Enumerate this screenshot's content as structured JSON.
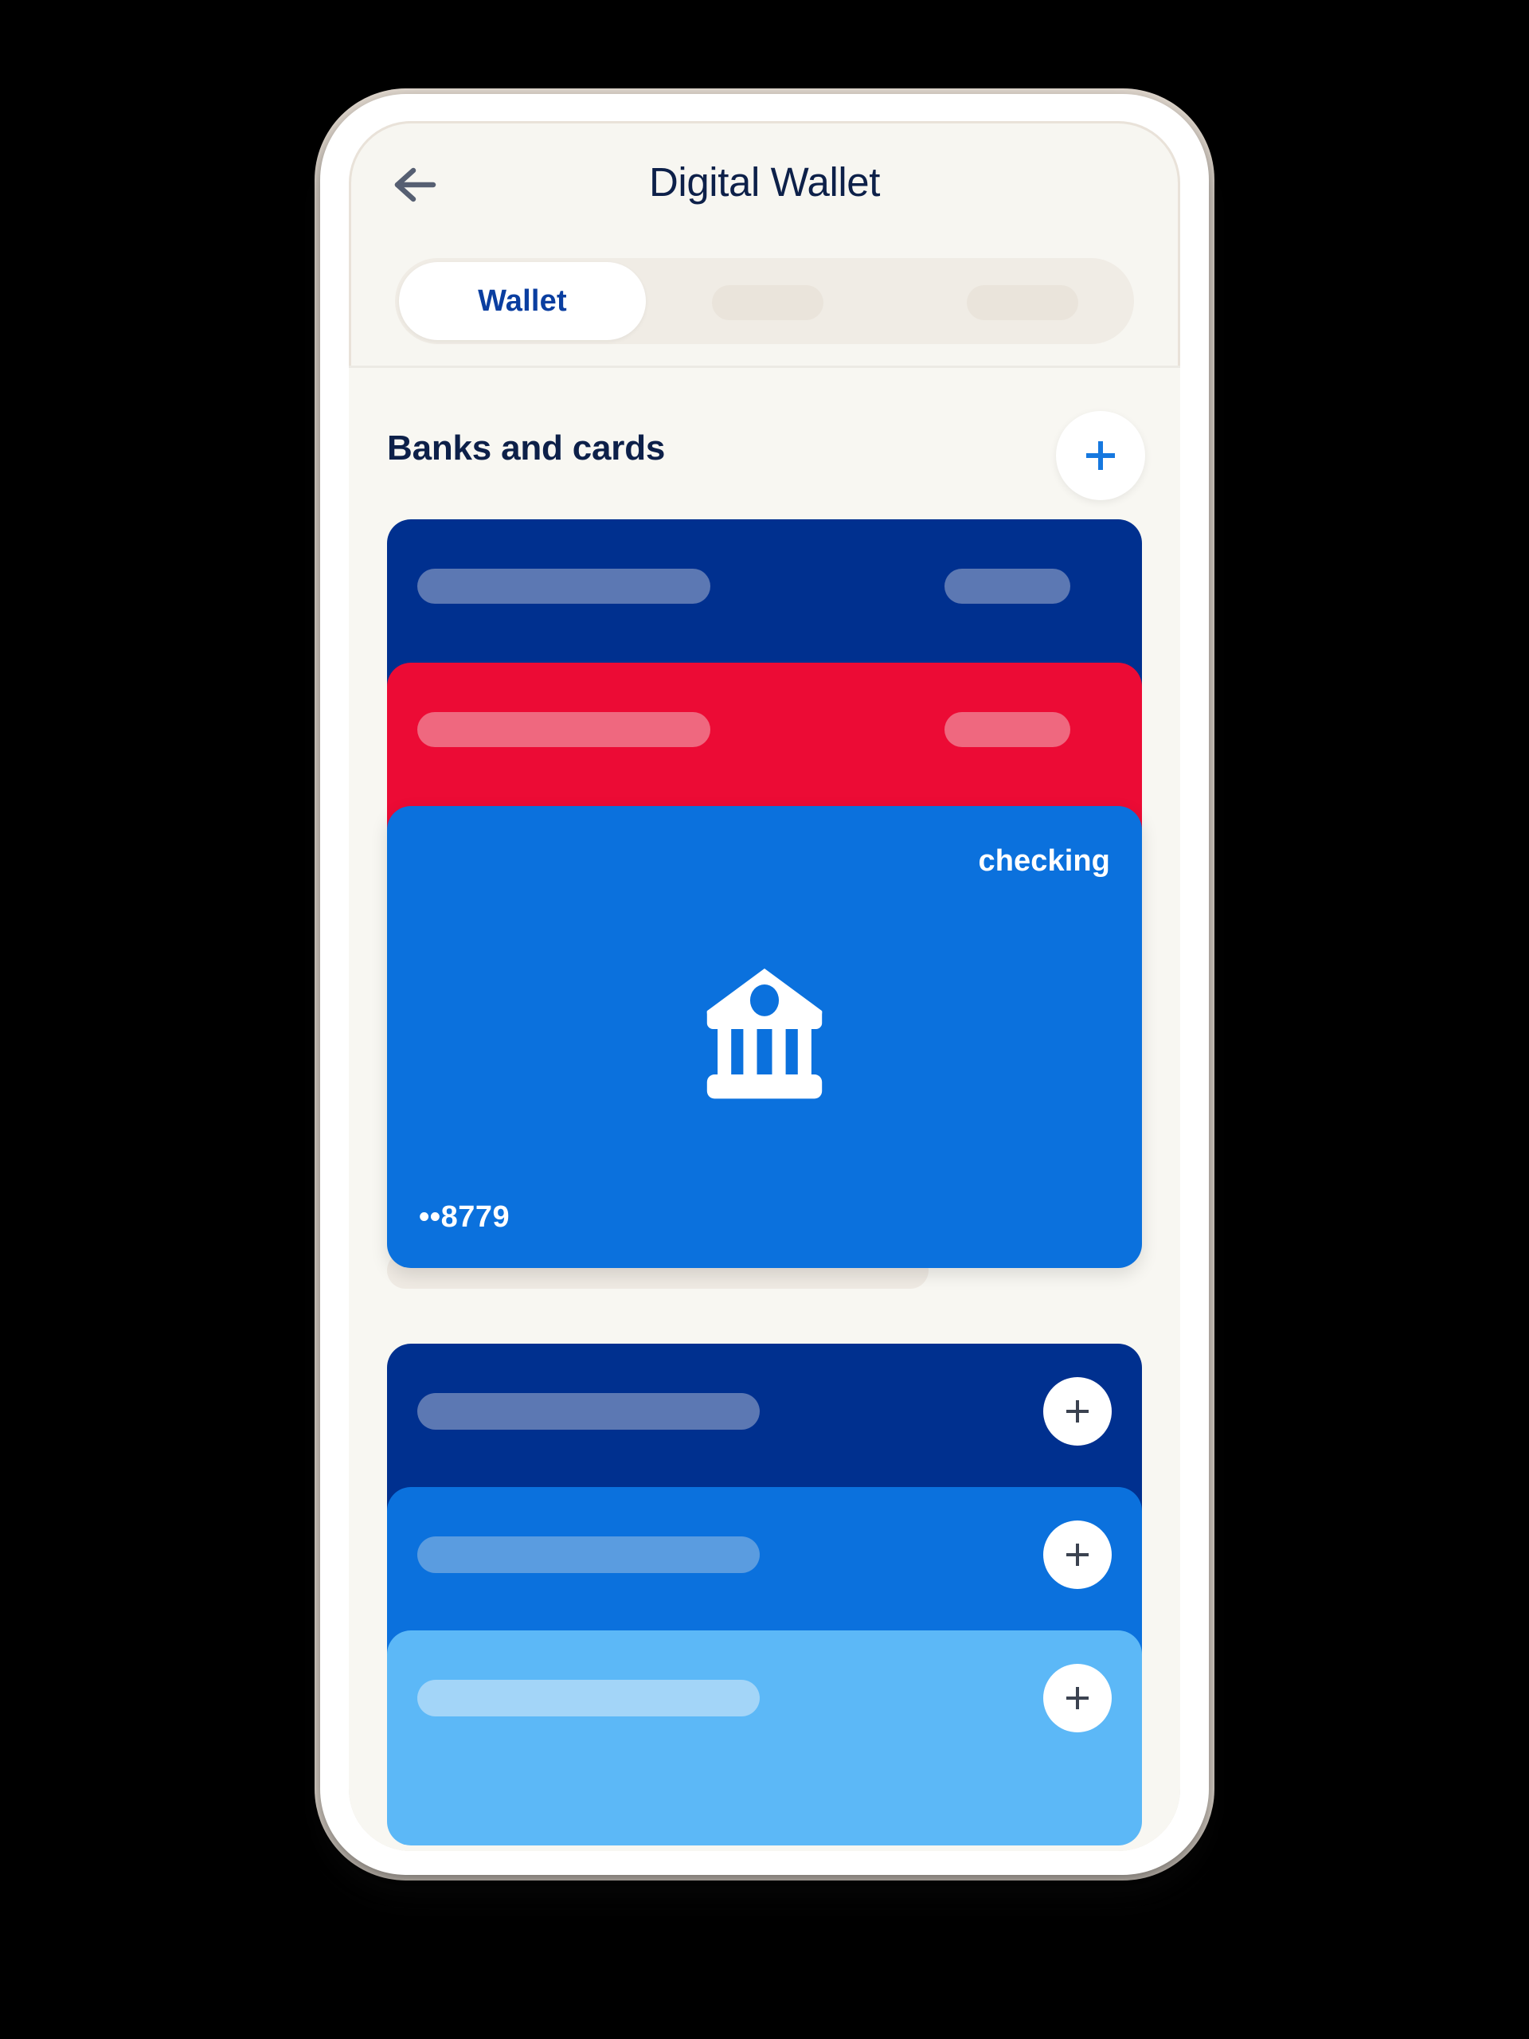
{
  "header": {
    "title": "Digital Wallet",
    "back_icon": "arrow-left-icon"
  },
  "tabs": {
    "active_label": "Wallet",
    "ghost_tabs": [
      "",
      ""
    ]
  },
  "section": {
    "title": "Banks and cards",
    "add_icon": "plus-icon"
  },
  "cards": [
    {
      "name": "card-navy",
      "color": "#00308f",
      "state": "collapsed"
    },
    {
      "name": "card-red",
      "color": "#ec0b35",
      "state": "collapsed"
    },
    {
      "name": "card-blue",
      "color": "#0b71dd",
      "state": "expanded",
      "account_type": "checking",
      "masked_number": "••8779",
      "icon": "bank-icon"
    }
  ],
  "add_rows": [
    {
      "name": "add-row-navy",
      "color": "#00308f",
      "action_icon": "plus-icon"
    },
    {
      "name": "add-row-blue",
      "color": "#0b71dd",
      "action_icon": "plus-icon"
    },
    {
      "name": "add-row-lightblue",
      "color": "#5cb8f7",
      "action_icon": "plus-icon"
    }
  ],
  "colors": {
    "accent_blue": "#1678df",
    "brand_navy": "#0d2049",
    "tab_active_text": "#0a3ea0",
    "screen_bg": "#f8f7f2",
    "frame": "#ffffff",
    "backdrop": "#000000"
  }
}
